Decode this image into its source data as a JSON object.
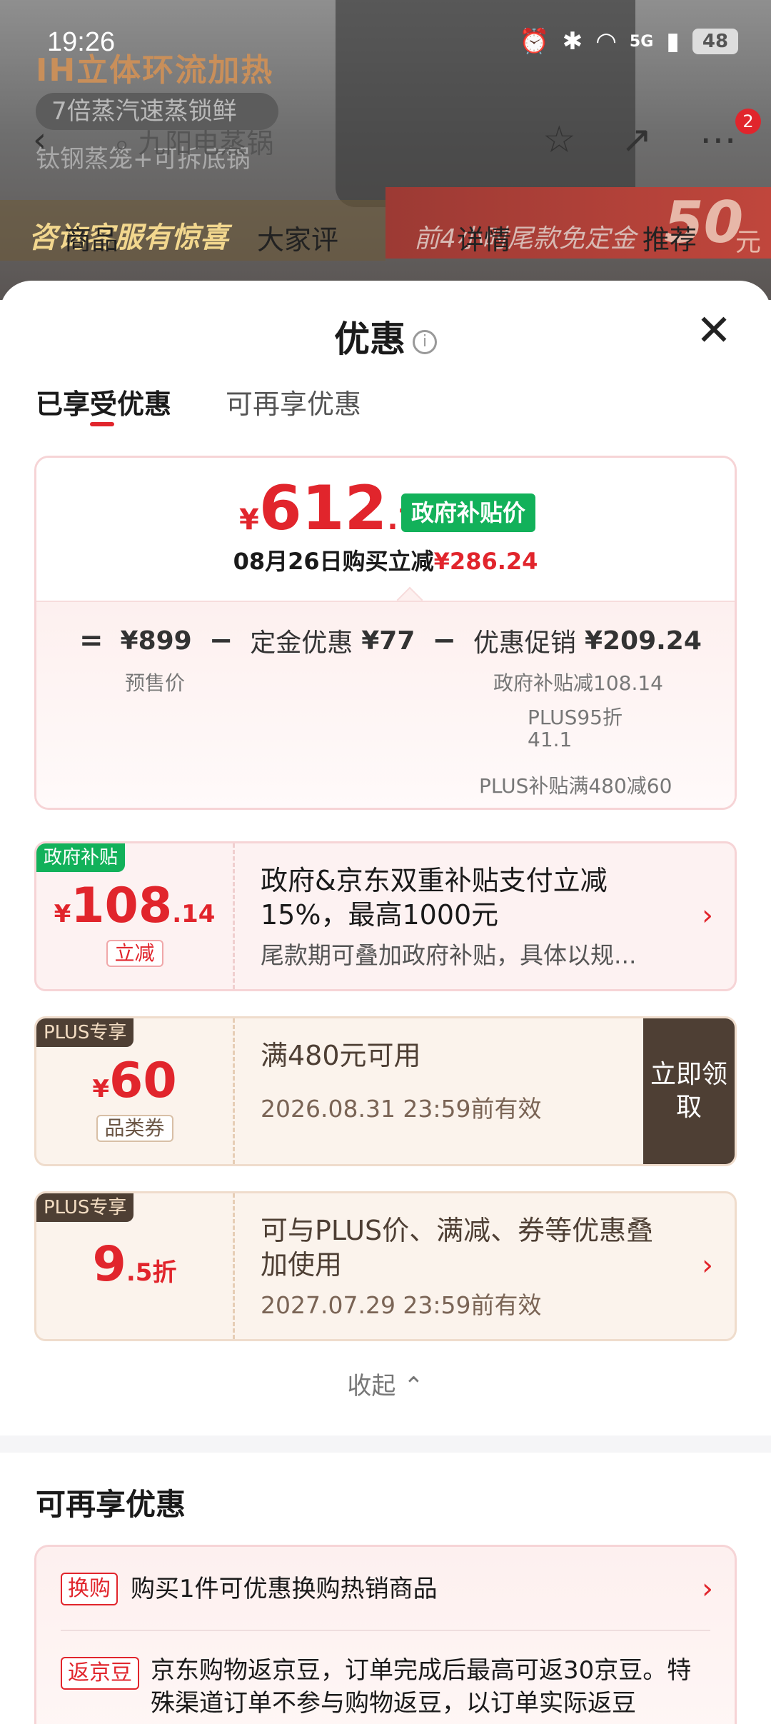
{
  "status_bar": {
    "time": "19:26",
    "network": "5G",
    "battery": "48"
  },
  "background_page": {
    "ih_text": "IH立体环流加热",
    "steam_text": "7倍蒸汽速蒸锁鲜",
    "steel_text": "钛钢蒸笼+可拆底锅",
    "search_text": "九阳电蒸锅",
    "kefu_text": "咨询客服有惊喜",
    "promo_text": "前4小时尾款免定金",
    "fifty": "50",
    "yuan": "元",
    "tabs": [
      "商品",
      "大家评",
      "详情",
      "推荐"
    ],
    "cart_badge": "2"
  },
  "sheet": {
    "title": "优惠",
    "tabs": [
      {
        "label": "已享受优惠",
        "active": true
      },
      {
        "label": "可再享优惠",
        "active": false
      }
    ]
  },
  "summary": {
    "price_symbol": "¥",
    "price_int": "612",
    "price_dec": ".76",
    "gov_tag": "政府补贴价",
    "date_text": "08月26日购买立减",
    "saving": "¥286.24",
    "eq": "=",
    "presale_price": "¥899",
    "minus": "−",
    "deposit_label": "定金优惠",
    "deposit_value": "¥77",
    "promo_label": "优惠促销",
    "promo_value": "¥209.24",
    "presale_label": "预售价",
    "sub_gov": "政府补贴减108.14",
    "sub_plus95_a": "PLUS95折",
    "sub_plus95_b": "41.1",
    "sub_plus_bonus": "PLUS补贴满480减60"
  },
  "coupons": [
    {
      "tag": "政府补贴",
      "symbol": "¥",
      "amount_int": "108",
      "amount_dec": ".14",
      "sub": "立减",
      "title": "政府&京东双重补贴支付立减15%，最高1000元",
      "desc": "尾款期可叠加政府补贴，具体以规..."
    },
    {
      "tag": "PLUS专享",
      "symbol": "¥",
      "amount_int": "60",
      "sub": "品类券",
      "title": "满480元可用",
      "desc": "2026.08.31 23:59前有效",
      "claim": "立即领取"
    },
    {
      "tag": "PLUS专享",
      "amount_int": "9",
      "amount_dec": ".5折",
      "title": "可与PLUS价、满减、券等优惠叠加使用",
      "desc": "2027.07.29 23:59前有效"
    }
  ],
  "collapse_label": "收起",
  "more_section": {
    "title": "可再享优惠",
    "rows": [
      {
        "tag": "换购",
        "text": "购买1件可优惠换购热销商品"
      },
      {
        "tag": "返京豆",
        "text": "京东购物返京豆，订单完成后最高可返30京豆。特殊渠道订单不参与购物返豆，以订单实际返豆"
      }
    ]
  },
  "colors": {
    "accent_red": "#e1252c",
    "gov_green": "#12b15a",
    "plus_brown": "#4e3f34"
  }
}
